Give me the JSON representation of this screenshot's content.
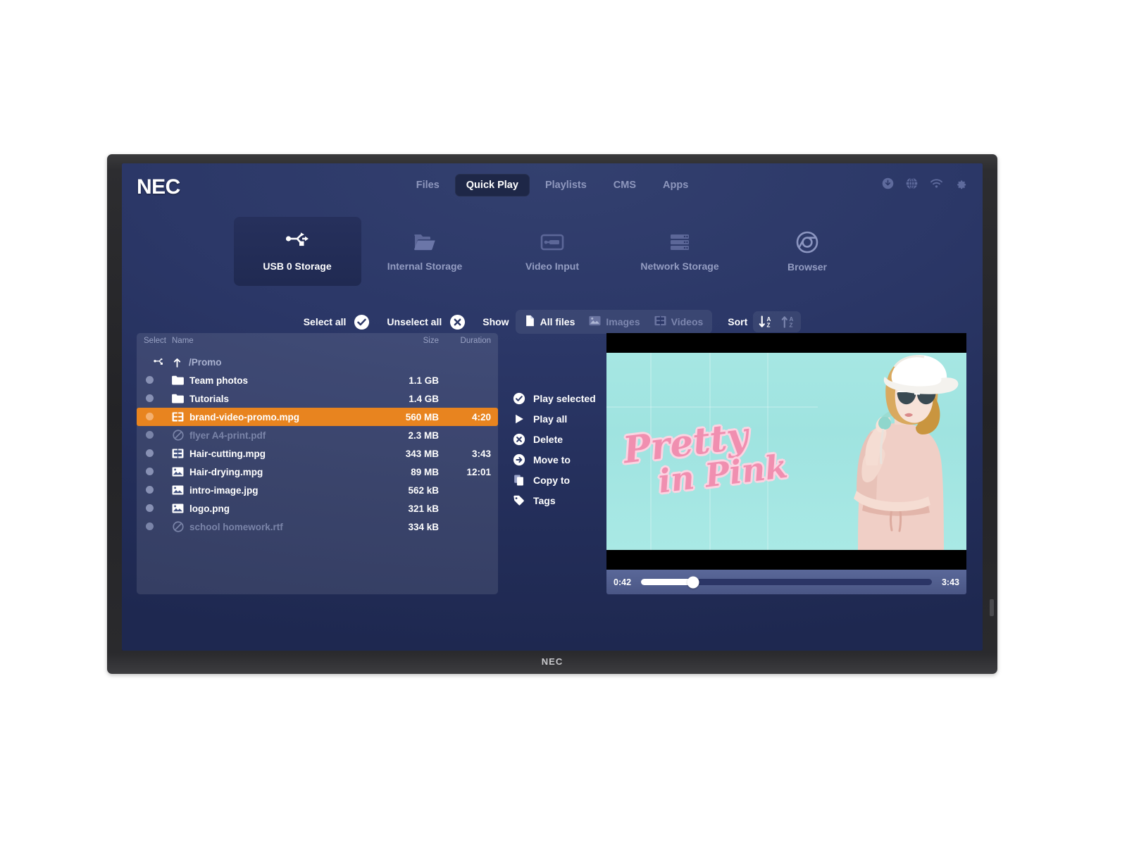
{
  "device": {
    "brand": "NEC",
    "bezel_logo": "NEC"
  },
  "topnav": {
    "items": [
      {
        "label": "Files",
        "active": false
      },
      {
        "label": "Quick Play",
        "active": true
      },
      {
        "label": "Playlists",
        "active": false
      },
      {
        "label": "CMS",
        "active": false
      },
      {
        "label": "Apps",
        "active": false
      }
    ],
    "sys_icons": [
      "download-icon",
      "globe-icon",
      "wifi-icon",
      "gear-icon"
    ]
  },
  "sources": [
    {
      "label": "USB 0 Storage",
      "icon": "usb-icon",
      "active": true
    },
    {
      "label": "Internal Storage",
      "icon": "folder-open-icon",
      "active": false
    },
    {
      "label": "Video Input",
      "icon": "video-input-icon",
      "active": false
    },
    {
      "label": "Network Storage",
      "icon": "server-icon",
      "active": false
    },
    {
      "label": "Browser",
      "icon": "chrome-icon",
      "active": false
    }
  ],
  "toolbar": {
    "select_all_label": "Select all",
    "unselect_all_label": "Unselect all",
    "show_label": "Show",
    "sort_label": "Sort",
    "filters": [
      {
        "label": "All files",
        "icon": "file-icon",
        "active": true
      },
      {
        "label": "Images",
        "icon": "image-icon",
        "active": false
      },
      {
        "label": "Videos",
        "icon": "film-icon",
        "active": false
      }
    ],
    "sort_buttons": [
      {
        "name": "sort-descending",
        "active": true
      },
      {
        "name": "sort-ascending",
        "active": false
      }
    ]
  },
  "filelist": {
    "columns": {
      "select": "Select",
      "name": "Name",
      "size": "Size",
      "duration": "Duration"
    },
    "breadcrumb": "/Promo",
    "rows": [
      {
        "name": "Team photos",
        "size": "1.1 GB",
        "duration": "",
        "icon": "folder-icon",
        "state": "normal"
      },
      {
        "name": "Tutorials",
        "size": "1.4 GB",
        "duration": "",
        "icon": "folder-icon",
        "state": "normal"
      },
      {
        "name": "brand-video-promo.mpg",
        "size": "560 MB",
        "duration": "4:20",
        "icon": "film-icon",
        "state": "selected"
      },
      {
        "name": "flyer A4-print.pdf",
        "size": "2.3 MB",
        "duration": "",
        "icon": "blocked-icon",
        "state": "disabled"
      },
      {
        "name": "Hair-cutting.mpg",
        "size": "343 MB",
        "duration": "3:43",
        "icon": "film-icon",
        "state": "normal"
      },
      {
        "name": "Hair-drying.mpg",
        "size": "89 MB",
        "duration": "12:01",
        "icon": "image-icon",
        "state": "normal"
      },
      {
        "name": "intro-image.jpg",
        "size": "562 kB",
        "duration": "",
        "icon": "image-icon",
        "state": "normal"
      },
      {
        "name": "logo.png",
        "size": "321 kB",
        "duration": "",
        "icon": "image-icon",
        "state": "normal"
      },
      {
        "name": "school homework.rtf",
        "size": "334 kB",
        "duration": "",
        "icon": "blocked-icon",
        "state": "disabled"
      }
    ]
  },
  "actions": [
    {
      "label": "Play selected",
      "icon": "check-circle-icon"
    },
    {
      "label": "Play all",
      "icon": "play-icon"
    },
    {
      "label": "Delete",
      "icon": "x-circle-icon"
    },
    {
      "label": "Move to",
      "icon": "arrow-circle-icon"
    },
    {
      "label": "Copy to",
      "icon": "copy-icon"
    },
    {
      "label": "Tags",
      "icon": "tag-icon"
    }
  ],
  "player": {
    "current_time": "0:42",
    "total_time": "3:43",
    "progress_percent": 18,
    "poster_line1": "Pretty",
    "poster_line2": "in Pink"
  },
  "colors": {
    "screen_bg": "#2b3767",
    "accent_selected": "#e8841f",
    "nav_active_bg": "#1e2747",
    "muted_text": "#8e97bd",
    "poster_bg": "#a6e7e3",
    "poster_pink": "#f08fb0"
  }
}
